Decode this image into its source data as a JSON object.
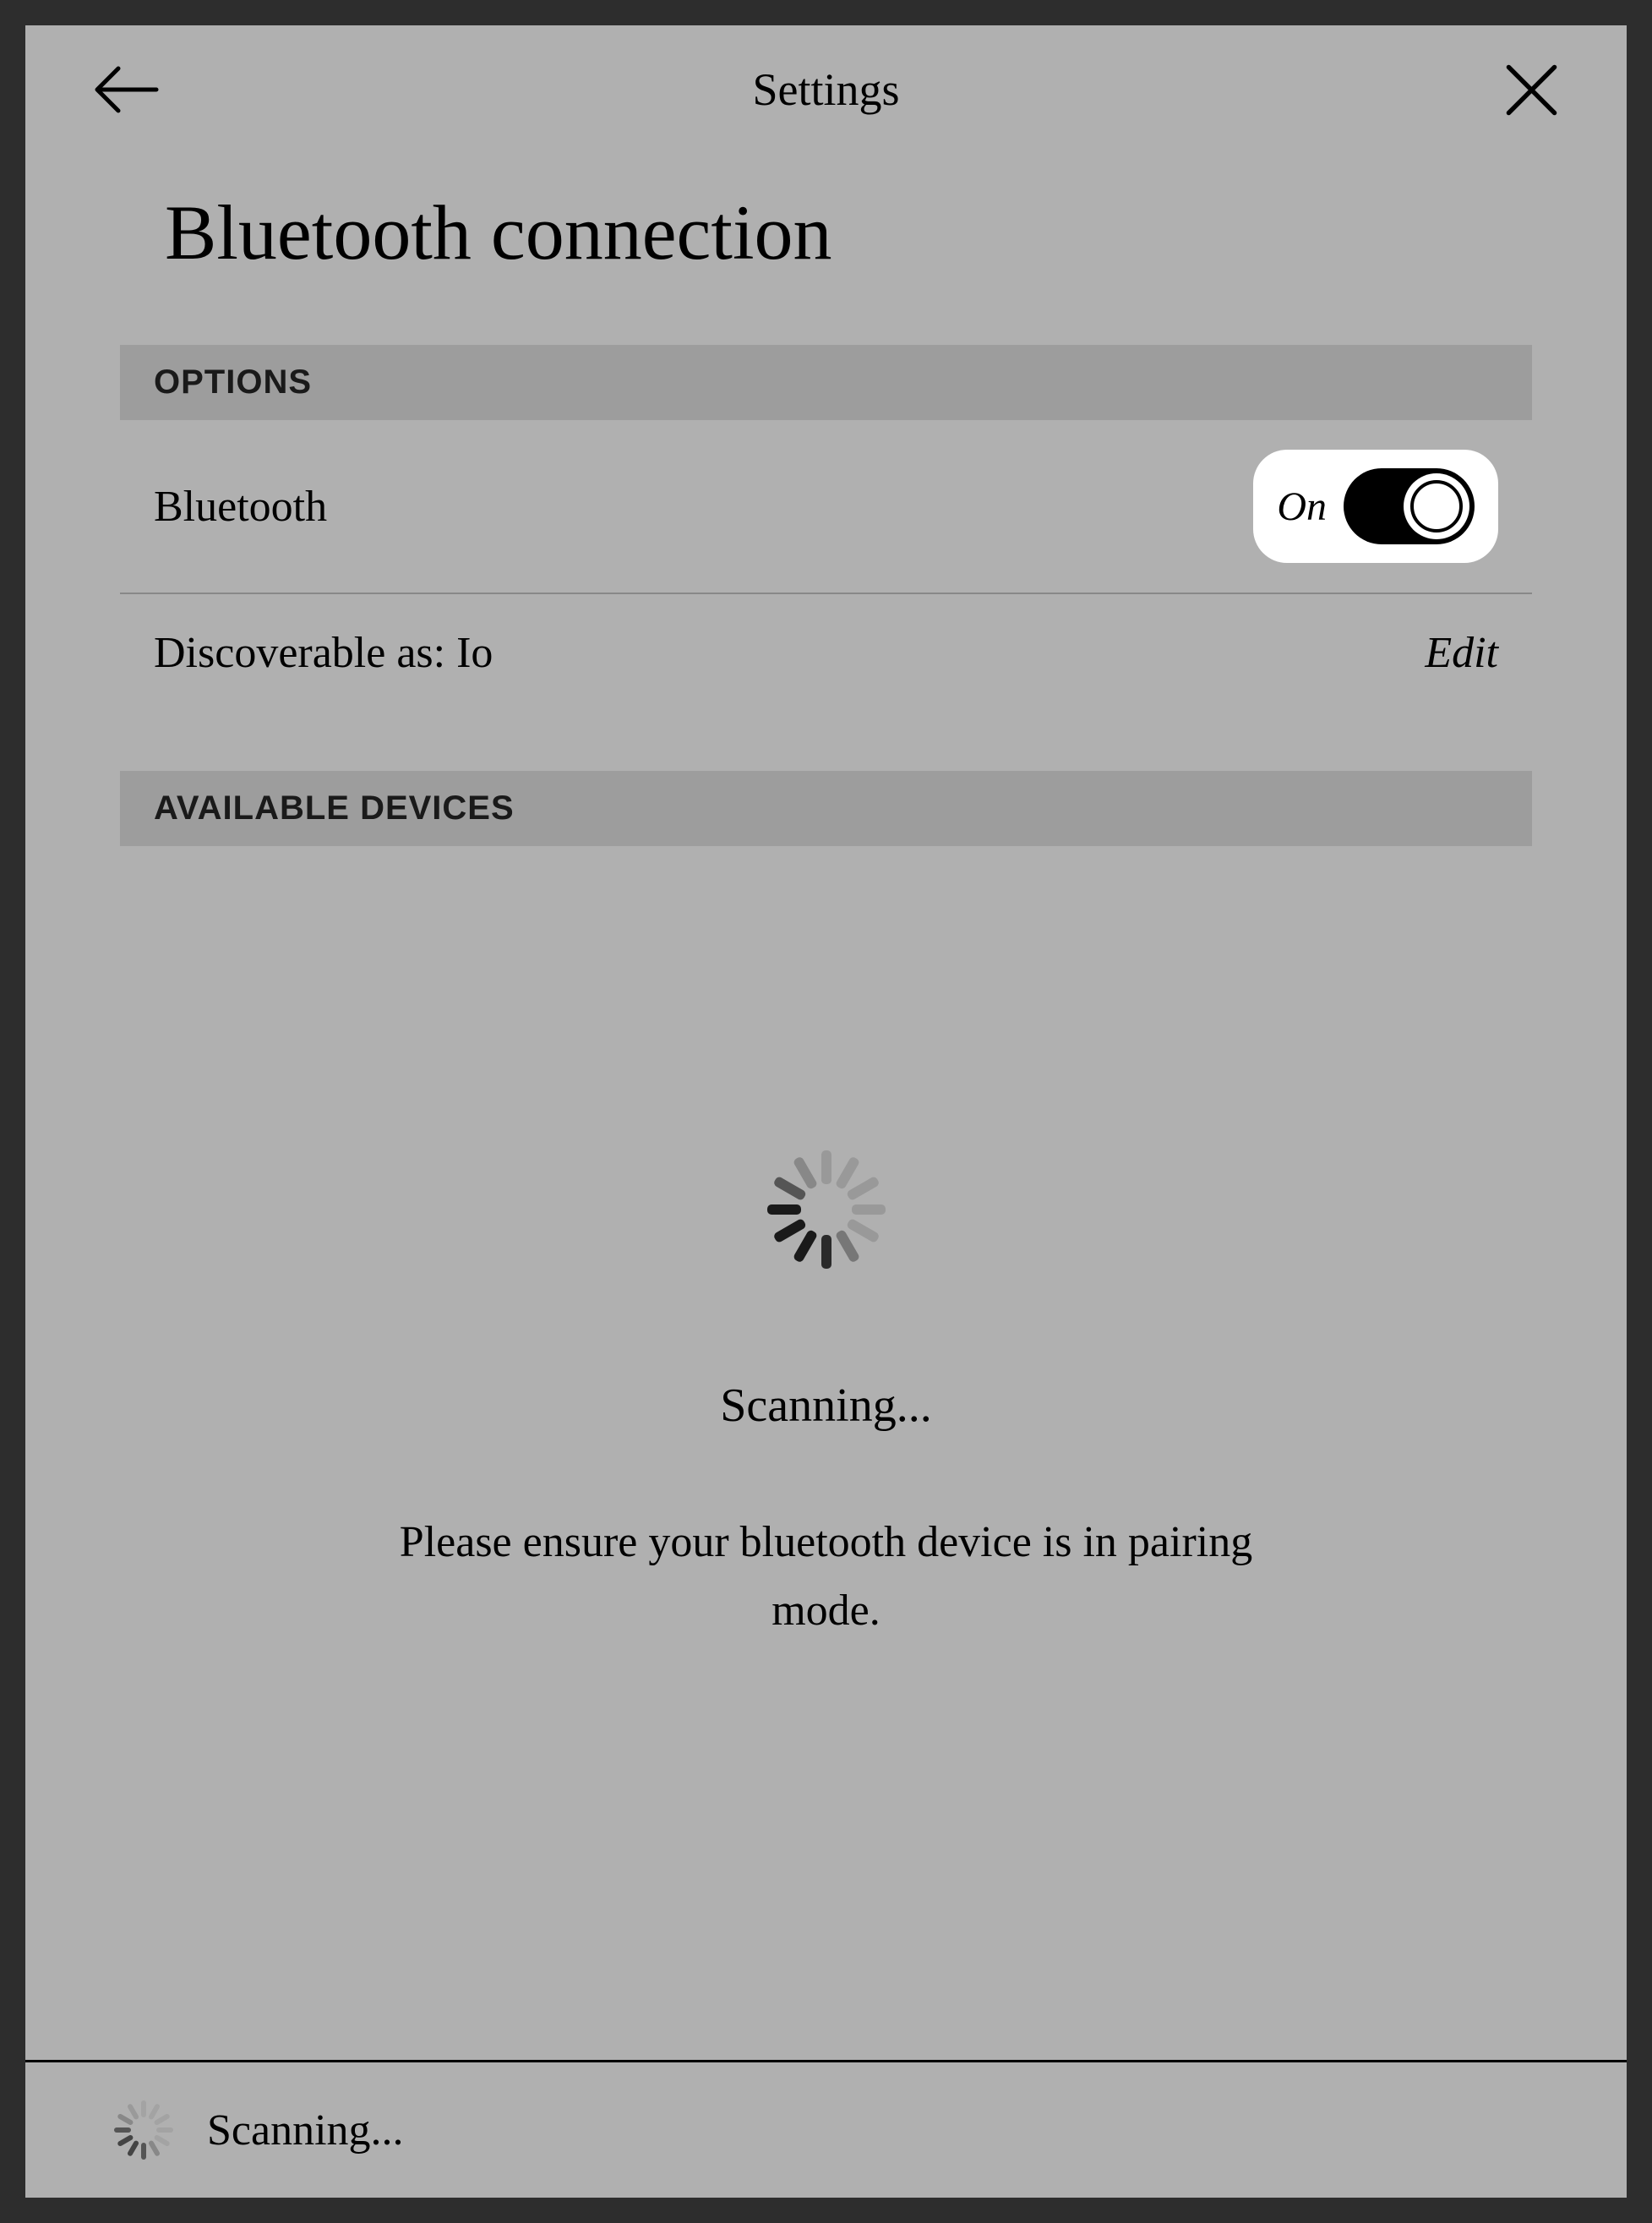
{
  "header": {
    "title": "Settings"
  },
  "page": {
    "title": "Bluetooth connection"
  },
  "options": {
    "section_label": "OPTIONS",
    "bluetooth_label": "Bluetooth",
    "toggle_state": "On",
    "discoverable_label": "Discoverable as: Io",
    "edit_label": "Edit"
  },
  "available": {
    "section_label": "AVAILABLE DEVICES"
  },
  "scanning": {
    "title": "Scanning...",
    "message": "Please ensure your bluetooth device is in pairing mode."
  },
  "footer": {
    "status": "Scanning..."
  }
}
